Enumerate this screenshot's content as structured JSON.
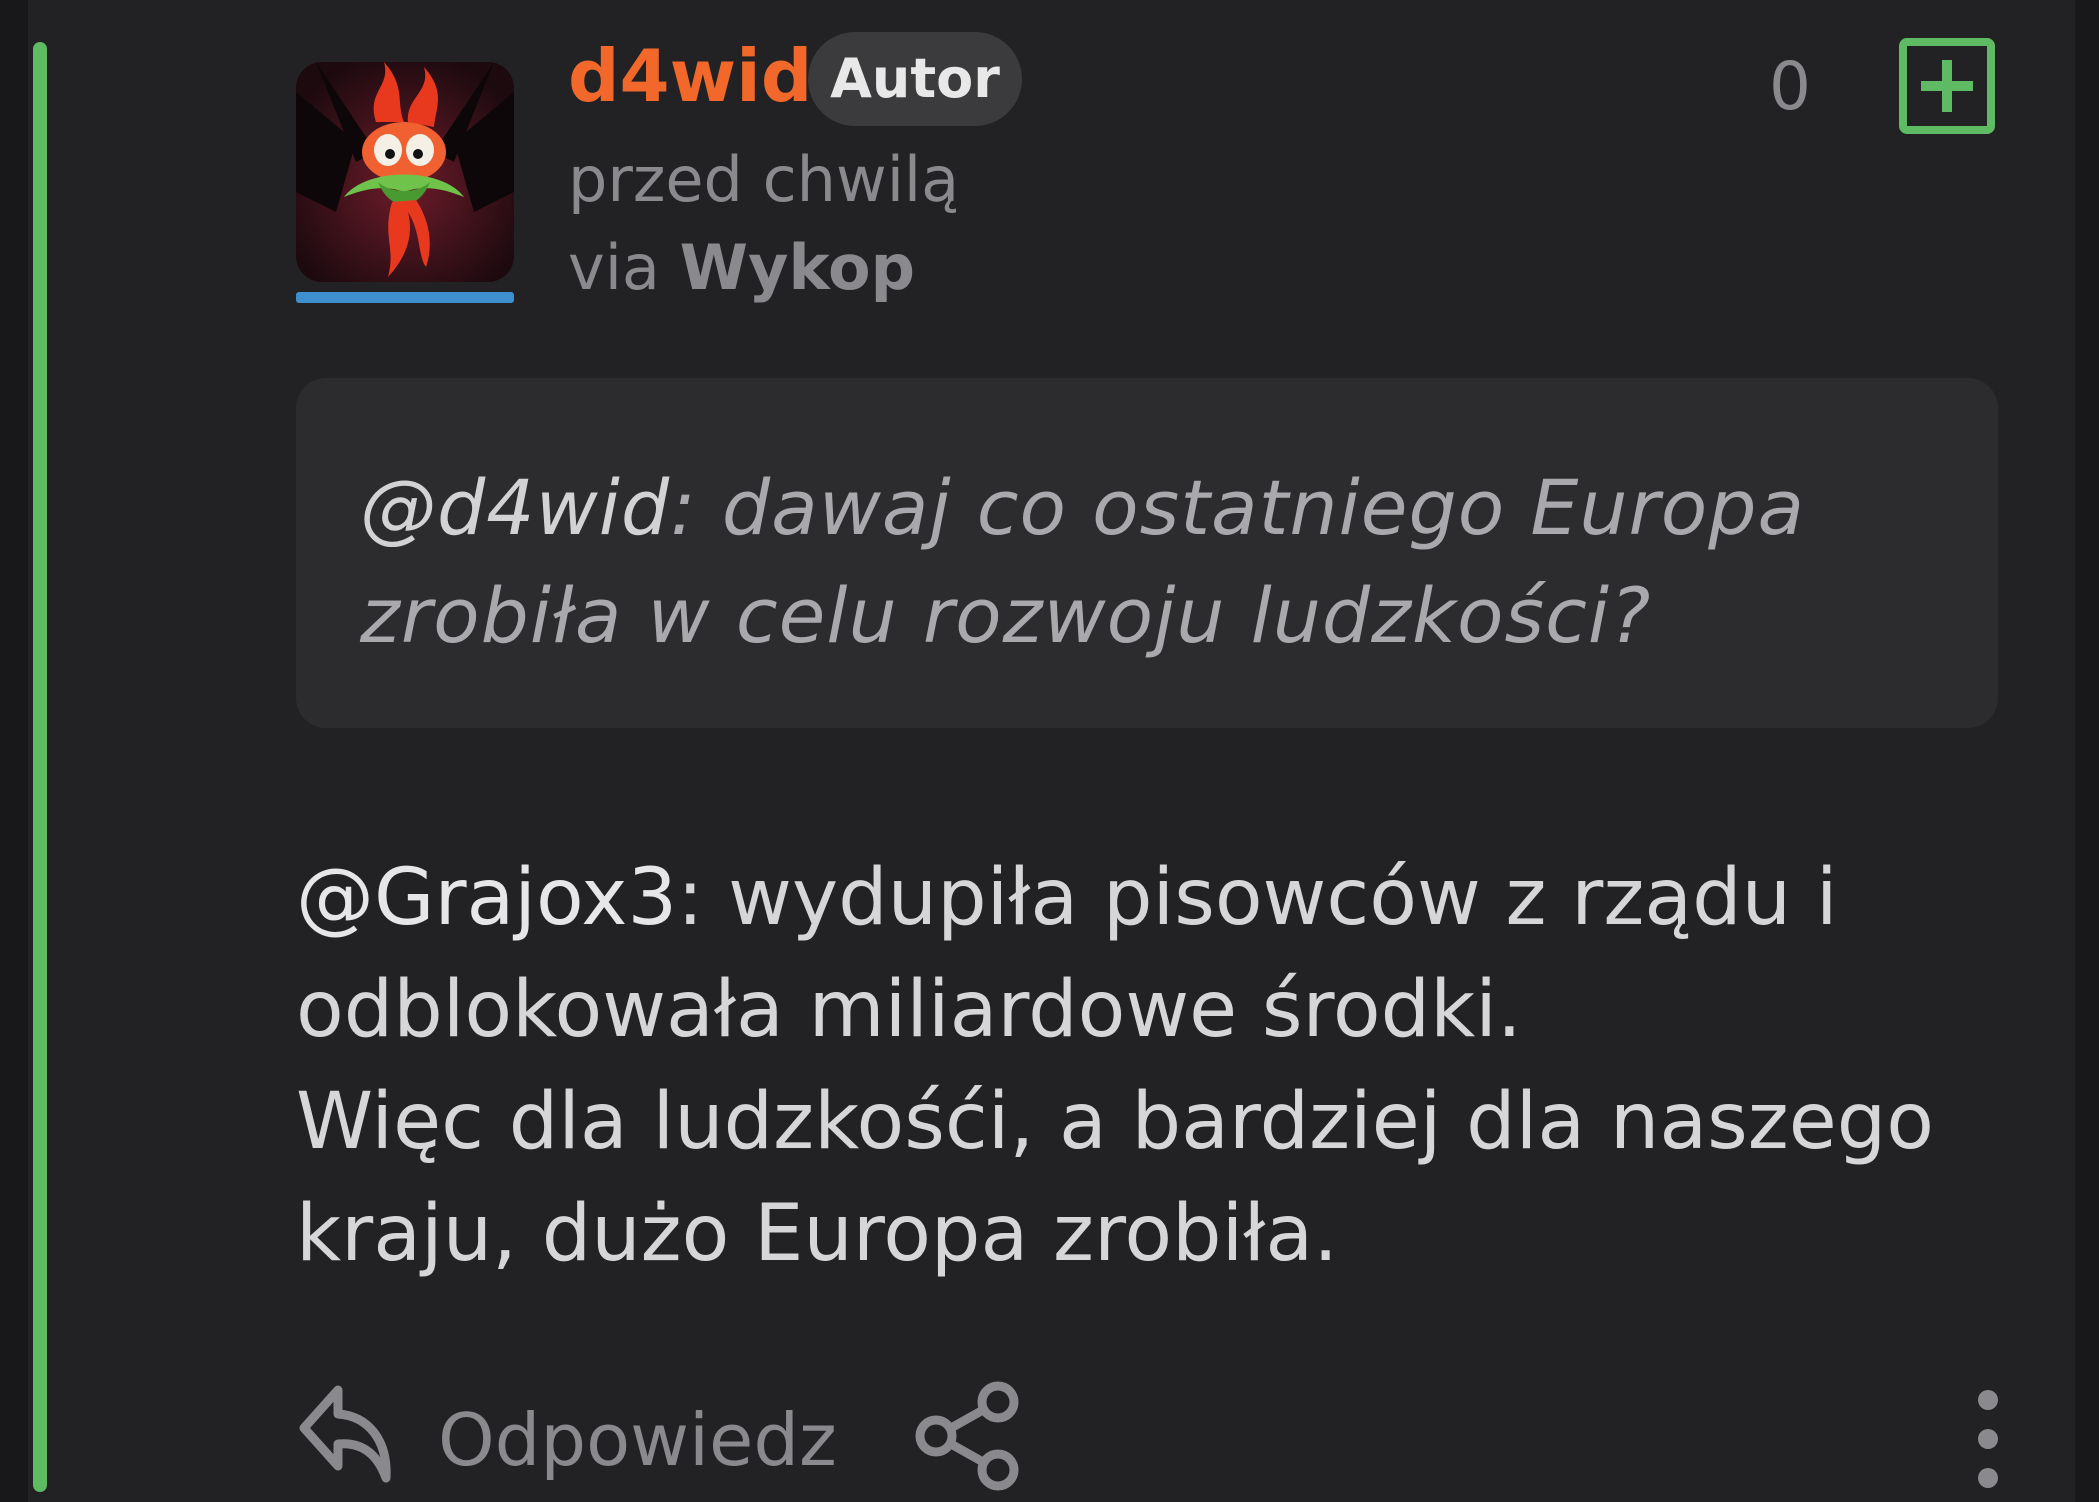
{
  "comment": {
    "author": "d4wid",
    "author_badge": "Autor",
    "time": "przed chwilą",
    "via_prefix": "via",
    "via_source": "Wykop",
    "vote_count": "0",
    "quote": {
      "mention": "@d4wid",
      "text": ": dawaj co ostatniego Europa zrobiła w celu rozwoju ludzkości?"
    },
    "body": {
      "mention": "@Grajox3",
      "line1": ": wydupiła pisowców z rządu i odblokowała miliardowe środki.",
      "line2": "Więc dla ludzkośći, a bardziej dla naszego kraju, dużo Europa zrobiła."
    },
    "actions": {
      "reply_label": "Odpowiedz"
    }
  },
  "colors": {
    "background": "#222224",
    "thread_line": "#5fbb63",
    "author_color": "#f2682b",
    "avatar_underline": "#3d8fd0",
    "plus_button": "#5fbb63"
  },
  "icons": [
    "avatar-image",
    "plus-icon",
    "reply-icon",
    "share-icon",
    "more-vertical-icon"
  ]
}
